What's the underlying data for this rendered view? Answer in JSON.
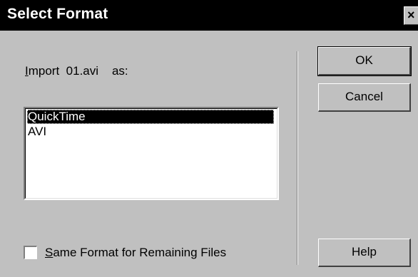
{
  "window": {
    "title": "Select Format",
    "close_glyph": "×"
  },
  "prompt": {
    "prefix_accel": "I",
    "prefix_rest": "mport",
    "filename": "01.avi",
    "suffix": "as:"
  },
  "formats": {
    "items": [
      "QuickTime",
      "AVI"
    ],
    "selected": "QuickTime"
  },
  "buttons": {
    "ok": "OK",
    "cancel": "Cancel",
    "help": "Help"
  },
  "checkbox": {
    "label_accel": "S",
    "label_rest": "ame Format for Remaining Files",
    "checked": false
  }
}
